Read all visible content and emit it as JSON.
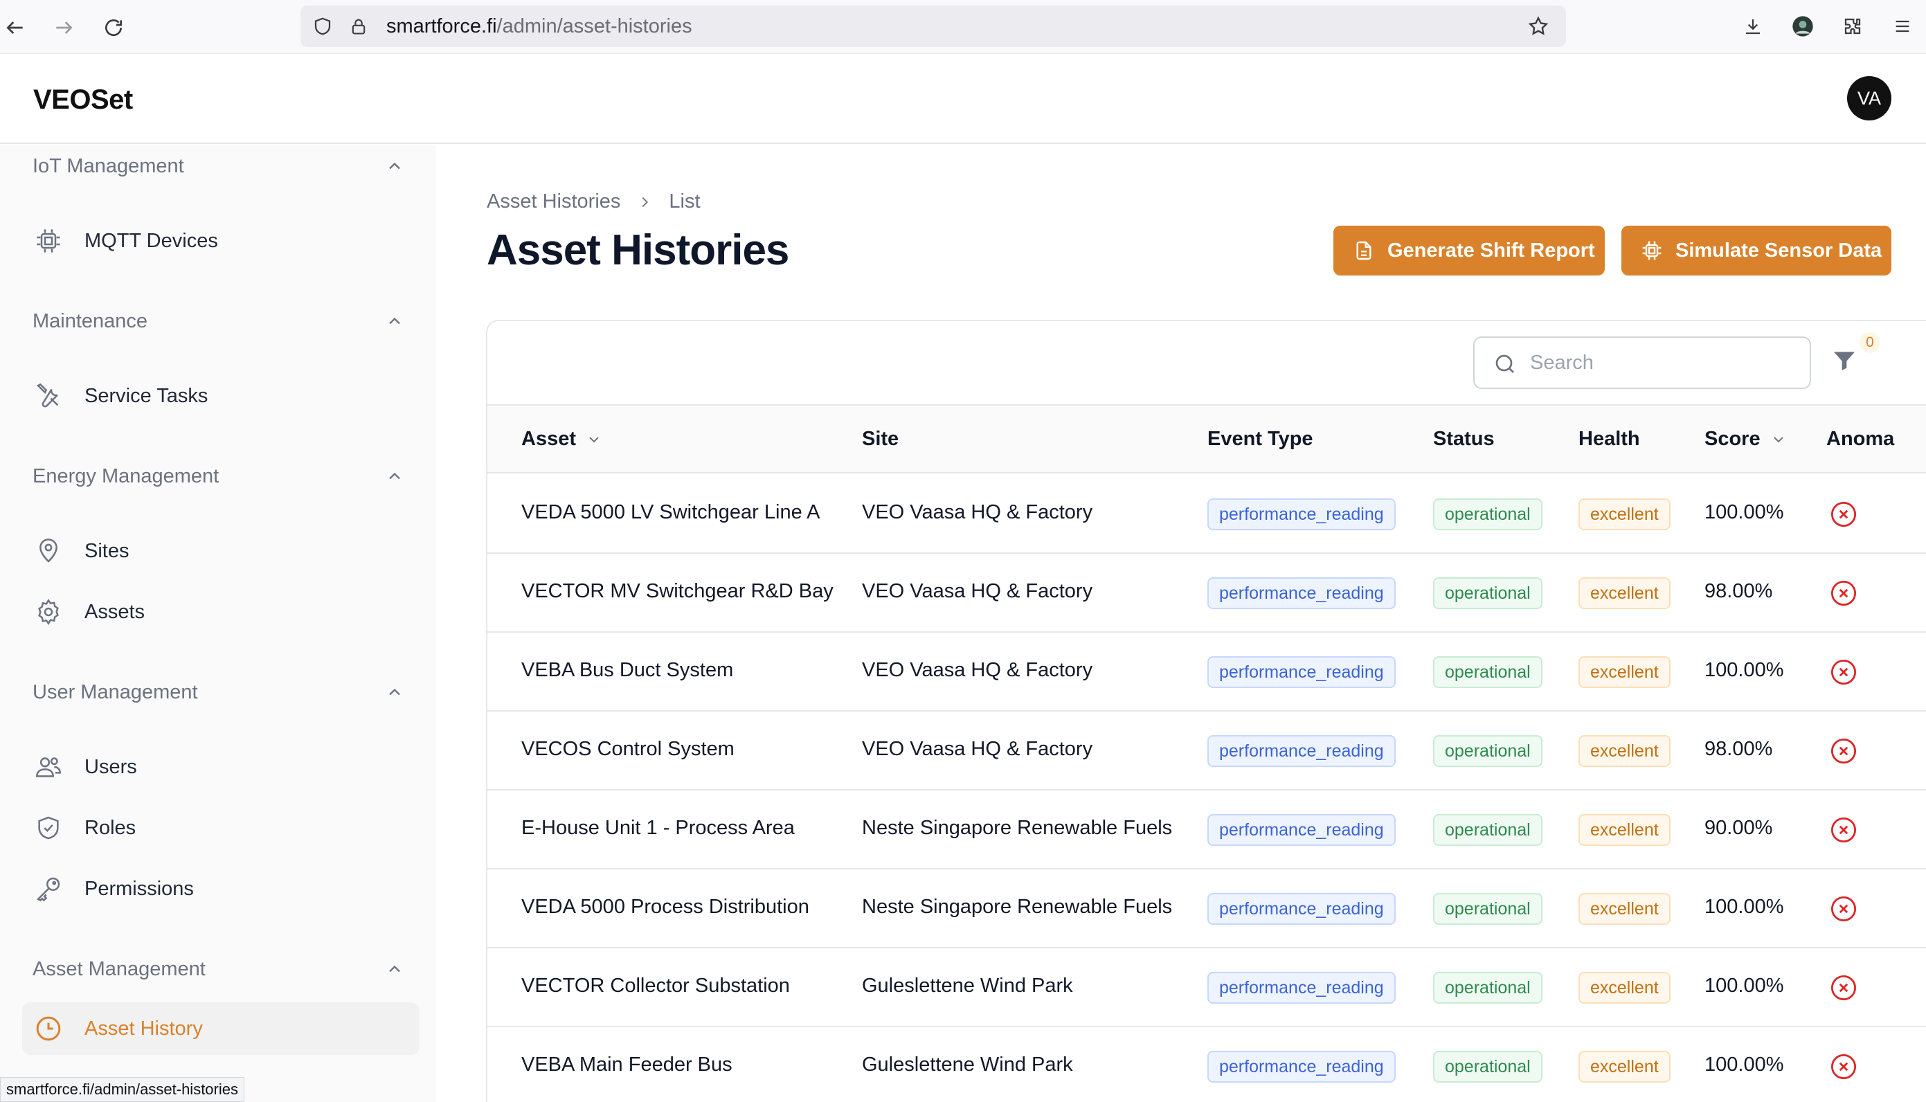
{
  "browser": {
    "url_host": "smartforce.fi",
    "url_path": "/admin/asset-histories"
  },
  "app": {
    "brand": "VEOSet",
    "avatar_initials": "VA",
    "accent_color": "#d9822b"
  },
  "sidebar": {
    "groups": [
      {
        "title": "IoT Management",
        "items": [
          {
            "label": "MQTT Devices",
            "icon": "chip-icon"
          }
        ]
      },
      {
        "title": "Maintenance",
        "items": [
          {
            "label": "Service Tasks",
            "icon": "tools-icon"
          }
        ]
      },
      {
        "title": "Energy Management",
        "items": [
          {
            "label": "Sites",
            "icon": "map-pin-icon"
          },
          {
            "label": "Assets",
            "icon": "gear-icon"
          }
        ]
      },
      {
        "title": "User Management",
        "items": [
          {
            "label": "Users",
            "icon": "users-icon"
          },
          {
            "label": "Roles",
            "icon": "shield-check-icon"
          },
          {
            "label": "Permissions",
            "icon": "key-icon"
          }
        ]
      },
      {
        "title": "Asset Management",
        "items": [
          {
            "label": "Asset History",
            "icon": "clock-icon",
            "active": true
          }
        ]
      }
    ]
  },
  "page": {
    "breadcrumb": [
      "Asset Histories",
      "List"
    ],
    "title": "Asset Histories",
    "actions": {
      "shift_report": "Generate Shift Report",
      "simulate": "Simulate Sensor Data"
    }
  },
  "table": {
    "search_placeholder": "Search",
    "filter_count": "0",
    "columns": [
      "Asset",
      "Site",
      "Event Type",
      "Status",
      "Health",
      "Score",
      "Anoma"
    ],
    "rows": [
      {
        "asset": "VEDA 5000 LV Switchgear Line A",
        "site": "VEO Vaasa HQ & Factory",
        "event_type": "performance_reading",
        "status": "operational",
        "health": "excellent",
        "score": "100.00%"
      },
      {
        "asset": "VECTOR MV Switchgear R&D Bay",
        "site": "VEO Vaasa HQ & Factory",
        "event_type": "performance_reading",
        "status": "operational",
        "health": "excellent",
        "score": "98.00%"
      },
      {
        "asset": "VEBA Bus Duct System",
        "site": "VEO Vaasa HQ & Factory",
        "event_type": "performance_reading",
        "status": "operational",
        "health": "excellent",
        "score": "100.00%"
      },
      {
        "asset": "VECOS Control System",
        "site": "VEO Vaasa HQ & Factory",
        "event_type": "performance_reading",
        "status": "operational",
        "health": "excellent",
        "score": "98.00%"
      },
      {
        "asset": "E-House Unit 1 - Process Area",
        "site": "Neste Singapore Renewable Fuels",
        "event_type": "performance_reading",
        "status": "operational",
        "health": "excellent",
        "score": "90.00%"
      },
      {
        "asset": "VEDA 5000 Process Distribution",
        "site": "Neste Singapore Renewable Fuels",
        "event_type": "performance_reading",
        "status": "operational",
        "health": "excellent",
        "score": "100.00%"
      },
      {
        "asset": "VECTOR Collector Substation",
        "site": "Guleslettene Wind Park",
        "event_type": "performance_reading",
        "status": "operational",
        "health": "excellent",
        "score": "100.00%"
      },
      {
        "asset": "VEBA Main Feeder Bus",
        "site": "Guleslettene Wind Park",
        "event_type": "performance_reading",
        "status": "operational",
        "health": "excellent",
        "score": "100.00%"
      }
    ]
  },
  "status_bar_url": "smartforce.fi/admin/asset-histories"
}
